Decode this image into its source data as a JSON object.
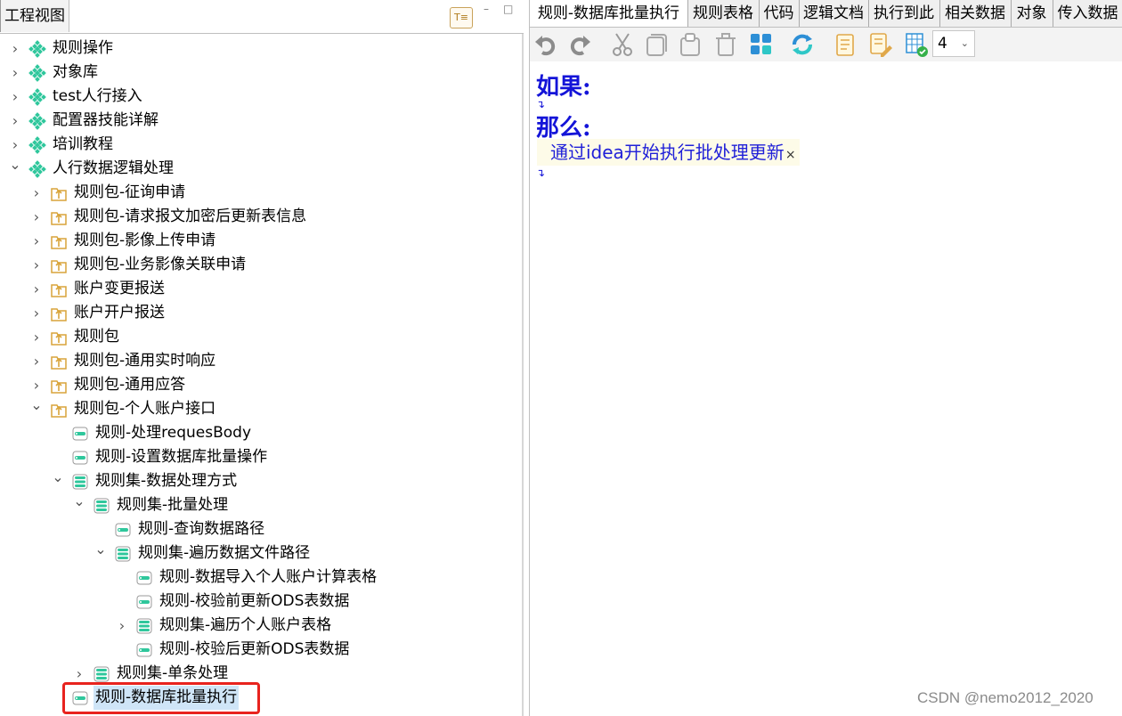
{
  "left_panel": {
    "title": "工程视图",
    "header_button": "T≡",
    "minimize": "–",
    "maximize": "□"
  },
  "tree": [
    {
      "label": "规则操作",
      "twisty": ">",
      "icon": "project-icon"
    },
    {
      "label": "对象库",
      "twisty": ">",
      "icon": "project-icon"
    },
    {
      "label": "test人行接入",
      "twisty": ">",
      "icon": "project-icon"
    },
    {
      "label": "配置器技能详解",
      "twisty": ">",
      "icon": "project-icon"
    },
    {
      "label": "培训教程",
      "twisty": ">",
      "icon": "project-icon"
    },
    {
      "label": "人行数据逻辑处理",
      "twisty": "v",
      "icon": "project-icon"
    },
    {
      "label": "规则包-征询申请",
      "twisty": ">",
      "icon": "package-icon"
    },
    {
      "label": "规则包-请求报文加密后更新表信息",
      "twisty": ">",
      "icon": "package-icon"
    },
    {
      "label": "规则包-影像上传申请",
      "twisty": ">",
      "icon": "package-icon"
    },
    {
      "label": "规则包-业务影像关联申请",
      "twisty": ">",
      "icon": "package-icon"
    },
    {
      "label": "账户变更报送",
      "twisty": ">",
      "icon": "package-icon"
    },
    {
      "label": "账户开户报送",
      "twisty": ">",
      "icon": "package-icon"
    },
    {
      "label": "规则包",
      "twisty": ">",
      "icon": "package-icon"
    },
    {
      "label": "规则包-通用实时响应",
      "twisty": ">",
      "icon": "package-icon"
    },
    {
      "label": "规则包-通用应答",
      "twisty": ">",
      "icon": "package-icon"
    },
    {
      "label": "规则包-个人账户接口",
      "twisty": "v",
      "icon": "package-icon"
    },
    {
      "label": "规则-处理requesBody",
      "twisty": "",
      "icon": "rule-icon"
    },
    {
      "label": "规则-设置数据库批量操作",
      "twisty": "",
      "icon": "rule-icon"
    },
    {
      "label": "规则集-数据处理方式",
      "twisty": "v",
      "icon": "ruleset-icon"
    },
    {
      "label": "规则集-批量处理",
      "twisty": "v",
      "icon": "ruleset-icon"
    },
    {
      "label": "规则-查询数据路径",
      "twisty": "",
      "icon": "rule-icon"
    },
    {
      "label": "规则集-遍历数据文件路径",
      "twisty": "v",
      "icon": "ruleset-icon"
    },
    {
      "label": "规则-数据导入个人账户计算表格",
      "twisty": "",
      "icon": "rule-icon"
    },
    {
      "label": "规则-校验前更新ODS表数据",
      "twisty": "",
      "icon": "rule-icon"
    },
    {
      "label": "规则集-遍历个人账户表格",
      "twisty": ">",
      "icon": "ruleset-icon"
    },
    {
      "label": "规则-校验后更新ODS表数据",
      "twisty": "",
      "icon": "rule-icon"
    },
    {
      "label": "规则集-单条处理",
      "twisty": ">",
      "icon": "ruleset-icon"
    },
    {
      "label": "规则-数据库批量执行",
      "twisty": "",
      "icon": "rule-icon",
      "selected": true
    }
  ],
  "editor_tabs": [
    "规则-数据库批量执行",
    "规则表格",
    "代码",
    "逻辑文档",
    "执行到此",
    "相关数据",
    "对象",
    "传入数据"
  ],
  "toolbar": {
    "icons": [
      "undo-icon",
      "redo-icon",
      "cut-icon",
      "copy-icon",
      "paste-icon",
      "delete-icon",
      "grid-icon",
      "refresh-icon",
      "doc-icon",
      "doc-edit-icon",
      "table-check-icon"
    ],
    "zoom_value": "4",
    "zoom_caret": "⌄"
  },
  "editor": {
    "if_label": "如果:",
    "then_label": "那么:",
    "enter_mark": "↴",
    "action_text": "通过idea开始执行批处理更新",
    "action_delete": "×"
  },
  "colors": {
    "keyword": "#1414d8",
    "action_text": "#2020d8",
    "selection_box": "#e8231e",
    "rule_icon": "#2fc79c",
    "package_icon": "#d9a43a"
  },
  "watermark": "CSDN @nemo2012_2020"
}
